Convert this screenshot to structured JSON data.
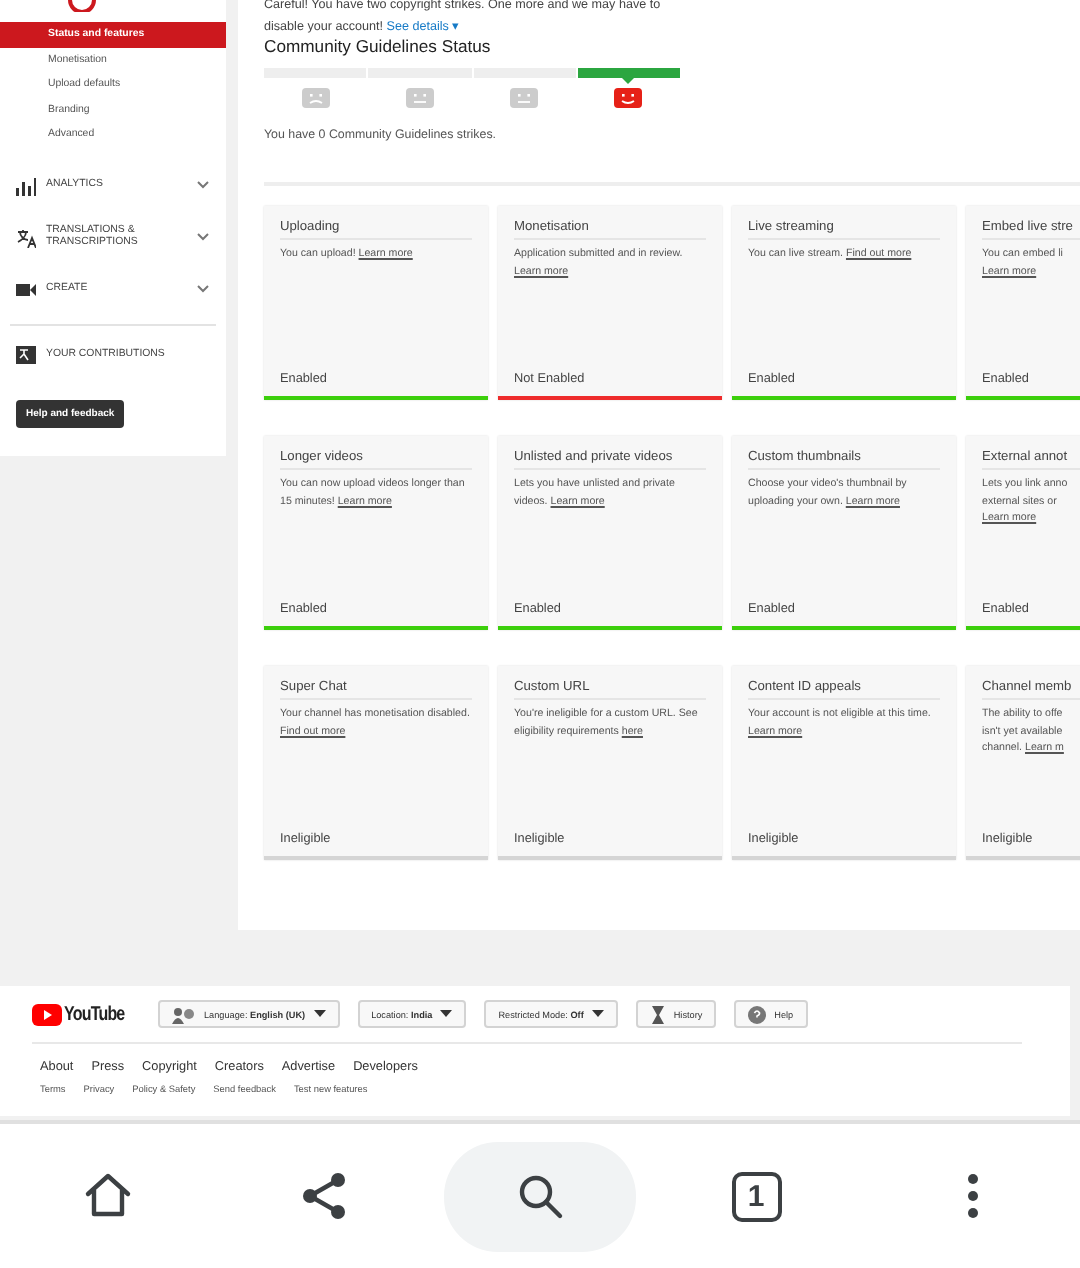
{
  "sidebar": {
    "items": [
      {
        "label": "Status and features",
        "selected": true
      },
      {
        "label": "Monetisation",
        "selected": false
      },
      {
        "label": "Upload defaults",
        "selected": false
      },
      {
        "label": "Branding",
        "selected": false
      },
      {
        "label": "Advanced",
        "selected": false
      }
    ],
    "sections": [
      {
        "kind": "analytics",
        "label": "ANALYTICS"
      },
      {
        "kind": "translate",
        "label": "TRANSLATIONS & TRANSCRIPTIONS"
      },
      {
        "kind": "create",
        "label": "CREATE"
      }
    ],
    "contributions": "YOUR CONTRIBUTIONS",
    "help_button": "Help and feedback"
  },
  "notice": {
    "text": "Careful! You have two copyright strikes. One more and we may have to disable your account!",
    "link": "See details ▾"
  },
  "guidelines": {
    "title": "Community Guidelines Status",
    "levels": [
      {
        "selected": false
      },
      {
        "selected": false
      },
      {
        "selected": false
      },
      {
        "selected": true
      }
    ],
    "summary": "You have 0 Community Guidelines strikes."
  },
  "features": [
    {
      "title": "Uploading",
      "description": "You can upload! ",
      "link": "Learn more",
      "status": "Enabled",
      "kind": "enabled"
    },
    {
      "title": "Monetisation",
      "description": "Application submitted and in review. ",
      "link": "Learn more",
      "status": "Not Enabled",
      "kind": "not_enabled"
    },
    {
      "title": "Live streaming",
      "description": "You can live stream. ",
      "link": "Find out more",
      "status": "Enabled",
      "kind": "enabled"
    },
    {
      "title": "Embed live stre",
      "description": "You can embed li\n",
      "link": "Learn more",
      "status": "Enabled",
      "kind": "enabled"
    },
    {
      "title": "Longer videos",
      "description": "You can now upload videos longer than 15 minutes! ",
      "link": "Learn more",
      "status": "Enabled",
      "kind": "enabled"
    },
    {
      "title": "Unlisted and private videos",
      "description": "Lets you have unlisted and private videos. ",
      "link": "Learn more",
      "status": "Enabled",
      "kind": "enabled"
    },
    {
      "title": "Custom thumbnails",
      "description": "Choose your video's thumbnail by uploading your own. ",
      "link": "Learn more",
      "status": "Enabled",
      "kind": "enabled"
    },
    {
      "title": "External annot",
      "description": "Lets you link anno\nexternal sites or\n",
      "link": "Learn more",
      "status": "Enabled",
      "kind": "enabled"
    },
    {
      "title": "Super Chat",
      "description": "Your channel has monetisation disabled. ",
      "link": "Find out more",
      "status": "Ineligible",
      "kind": "ineligible"
    },
    {
      "title": "Custom URL",
      "description": "You're ineligible for a custom URL. See eligibility requirements ",
      "link": "here",
      "status": "Ineligible",
      "kind": "ineligible"
    },
    {
      "title": "Content ID appeals",
      "description": "Your account is not eligible at this time. ",
      "link": "Learn more",
      "status": "Ineligible",
      "kind": "ineligible"
    },
    {
      "title": "Channel memb",
      "description": "The ability to offe\nisn't yet available\nchannel. ",
      "link": "Learn m",
      "status": "Ineligible",
      "kind": "ineligible"
    }
  ],
  "footer": {
    "logo": "YouTube",
    "buttons": [
      {
        "kind": "language",
        "label": "Language: **English (UK)**",
        "dropdown": true
      },
      {
        "kind": "location",
        "label": "Location: **India**",
        "dropdown": true
      },
      {
        "kind": "restricted",
        "label": "Restricted Mode: **Off**",
        "dropdown": true
      },
      {
        "kind": "history",
        "label": "History",
        "dropdown": false
      },
      {
        "kind": "help",
        "label": "Help",
        "dropdown": false
      }
    ],
    "links": [
      "About",
      "Press",
      "Copyright",
      "Creators",
      "Advertise",
      "Developers"
    ],
    "small_links": [
      "Terms",
      "Privacy",
      "Policy & Safety",
      "Send feedback",
      "Test new features"
    ]
  },
  "bottom_nav": [
    {
      "kind": "home",
      "selected": false
    },
    {
      "kind": "share",
      "selected": false
    },
    {
      "kind": "search",
      "selected": true
    },
    {
      "kind": "tabs",
      "count": "1",
      "selected": false
    },
    {
      "kind": "more",
      "selected": false
    }
  ]
}
